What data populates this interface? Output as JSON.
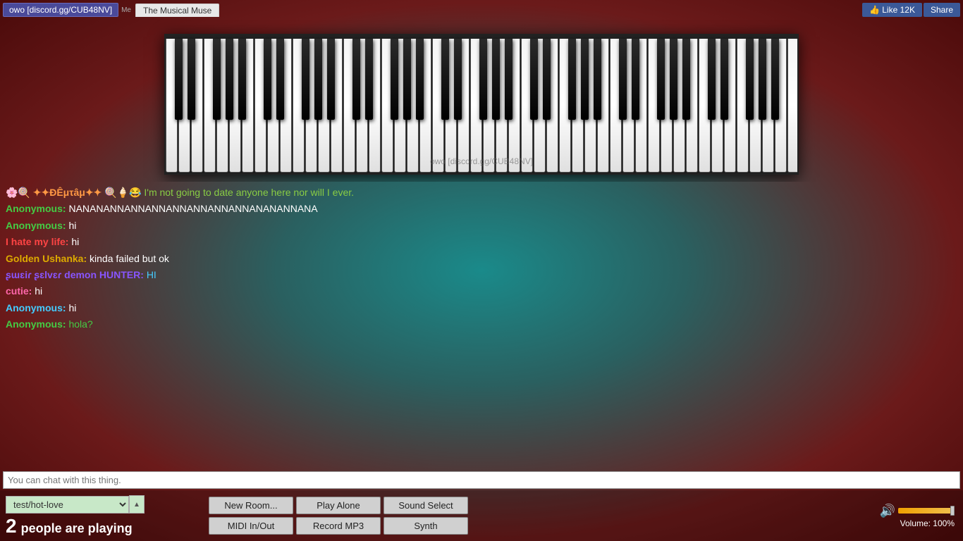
{
  "header": {
    "discord_btn_label": "owo [discord.gg/CUB48NV]",
    "me_label": "Me",
    "musical_muse_tab": "The Musical Muse",
    "fb_like_label": "👍 Like 12K",
    "fb_share_label": "Share"
  },
  "piano": {
    "watermark": "owo [discord.gg/CUB48NV]",
    "octave_count": 7
  },
  "chat": {
    "messages": [
      {
        "user": "🌸🍭 ✦✦ÐÊμτâμ✦✦ 🍭🍦😂",
        "user_color": "#ff9944",
        "text": "I'm not going to date anyone here nor will I ever.",
        "text_color": "#88cc44"
      },
      {
        "user": "Anonymous:",
        "user_color": "#44cc44",
        "text": "NANANANNANNANNANNANNANNANNANANANNANA",
        "text_color": "white"
      },
      {
        "user": "Anonymous:",
        "user_color": "#44cc44",
        "text": "hi",
        "text_color": "white"
      },
      {
        "user": "I hate my life:",
        "user_color": "#ff4444",
        "text": "hi",
        "text_color": "white"
      },
      {
        "user": "Golden Ushanka:",
        "user_color": "#ddaa00",
        "text": "kinda failed but ok",
        "text_color": "white"
      },
      {
        "user": "ʂɯɛiɾ ʂɛlvɛɾ demon HUNTER:",
        "user_color": "#8855ff",
        "text": "HI",
        "text_color": "#44ccff"
      },
      {
        "user": "cutie:",
        "user_color": "#ff66aa",
        "text": "hi",
        "text_color": "white"
      },
      {
        "user": "Anonymous:",
        "user_color": "#44ccff",
        "text": "hi",
        "text_color": "white"
      },
      {
        "user": "Anonymous:",
        "user_color": "#44cc44",
        "text": "hola?",
        "text_color": "#44cc44"
      }
    ],
    "input_placeholder": "You can chat with this thing."
  },
  "bottom_bar": {
    "room_name": "test/hot-love",
    "people_count": "2",
    "people_label": "people are playing",
    "new_room_label": "New Room...",
    "play_alone_label": "Play Alone",
    "sound_select_label": "Sound Select",
    "midi_label": "MIDI In/Out",
    "record_label": "Record MP3",
    "synth_label": "Synth",
    "volume_label": "Volume: 100%"
  }
}
